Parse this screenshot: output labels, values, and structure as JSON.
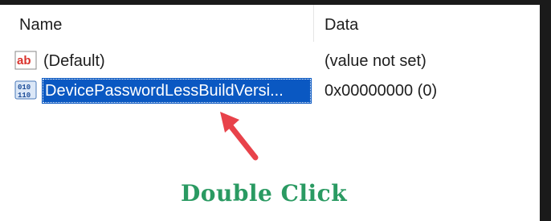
{
  "columns": {
    "name": "Name",
    "data": "Data"
  },
  "rows": [
    {
      "icon": "string-value-icon",
      "icon_text": "ab",
      "name": "(Default)",
      "data": "(value not set)"
    },
    {
      "icon": "binary-value-icon",
      "icon_text": "010 110",
      "name": "DevicePasswordLessBuildVersi...",
      "data": "0x00000000 (0)",
      "selected": true
    }
  ],
  "annotation": {
    "text": "Double Click",
    "color": "#2a9a62"
  },
  "colors": {
    "selection": "#0a58c2",
    "arrow": "#e8424a"
  }
}
